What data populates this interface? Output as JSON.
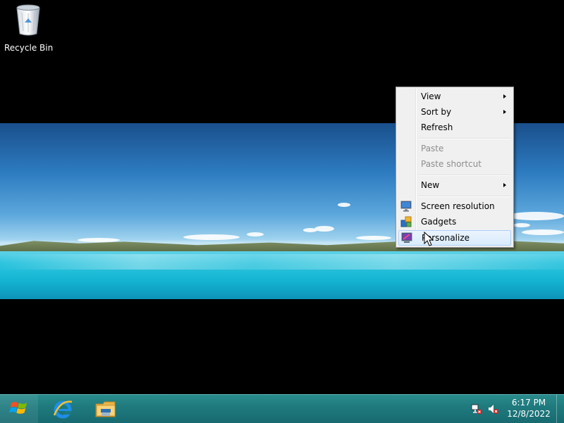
{
  "desktop": {
    "icons": [
      {
        "label": "Recycle Bin",
        "icon": "recycle-bin-icon"
      }
    ]
  },
  "context_menu": {
    "items": {
      "view": {
        "label": "View",
        "has_submenu": true
      },
      "sort_by": {
        "label": "Sort by",
        "has_submenu": true
      },
      "refresh": {
        "label": "Refresh"
      },
      "paste": {
        "label": "Paste",
        "disabled": true
      },
      "paste_shortcut": {
        "label": "Paste shortcut",
        "disabled": true
      },
      "new": {
        "label": "New",
        "has_submenu": true
      },
      "screen_resolution": {
        "label": "Screen resolution",
        "icon": "screen-resolution-icon"
      },
      "gadgets": {
        "label": "Gadgets",
        "icon": "gadgets-icon"
      },
      "personalize": {
        "label": "Personalize",
        "icon": "personalize-icon",
        "highlighted": true
      }
    }
  },
  "taskbar": {
    "pinned": [
      "start-button",
      "internet-explorer",
      "file-explorer"
    ],
    "tray": {
      "icons": [
        "network-icon",
        "volume-muted-icon"
      ],
      "time": "6:17 PM",
      "date": "12/8/2022"
    },
    "colors": {
      "bar": "#1f7a7e"
    }
  }
}
